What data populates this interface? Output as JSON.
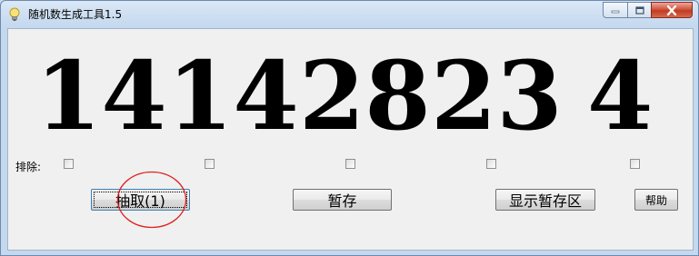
{
  "window": {
    "title": "随机数生成工具1.5",
    "icon": "lightbulb-icon"
  },
  "caption_buttons": {
    "minimize": "minimize-icon",
    "maximize": "maximize-icon",
    "close": "close-icon"
  },
  "numbers": [
    "14",
    "14",
    "28",
    "23",
    "4"
  ],
  "exclude": {
    "label": "排除:",
    "checked": [
      false,
      false,
      false,
      false,
      false
    ]
  },
  "buttons": {
    "draw": "抽取(1)",
    "stash": "暂存",
    "show_stash": "显示暂存区",
    "help": "帮助"
  },
  "annotation": {
    "color": "#e02020"
  }
}
